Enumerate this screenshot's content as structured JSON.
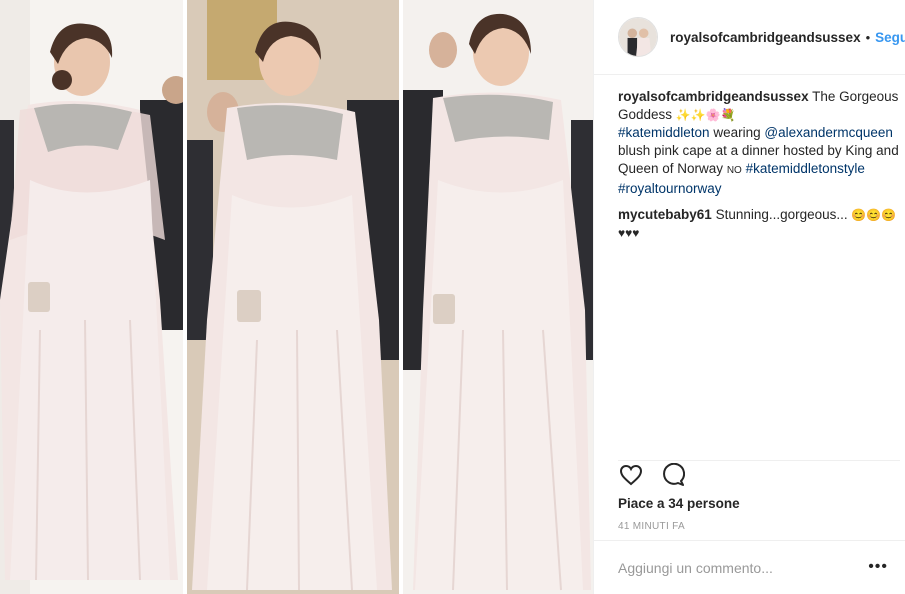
{
  "post": {
    "username": "royalsofcambridgeandsussex",
    "separator": "•",
    "follow_label": "Segui",
    "caption": {
      "user": "royalsofcambridgeandsussex",
      "text_1": "The Gorgeous Goddess",
      "emojis_1": "✨✨🌸💐",
      "tag_1": "#katemiddleton",
      "text_2": "wearing",
      "tag_2": "@alexandermcqueen",
      "text_3": "blush pink cape at a dinner hosted by King and Queen of Norway",
      "text_no": "NO",
      "tag_3": "#katemiddletonstyle",
      "tag_4": "#royaltournorway"
    },
    "comment": {
      "user": "mycutebaby61",
      "text": "Stunning...gorgeous...",
      "emojis": "😊😊😊 ♥♥♥"
    },
    "likes_text": "Piace a 34 persone",
    "time_text": "41 MINUTI FA",
    "add_comment_placeholder": "Aggiungi un commento...",
    "more_label": "•••"
  },
  "icons": {
    "like": "heart-icon",
    "comment": "comment-icon"
  },
  "colors": {
    "link": "#3897f0",
    "hashtag": "#003569",
    "dress": "#f3e8e6"
  }
}
